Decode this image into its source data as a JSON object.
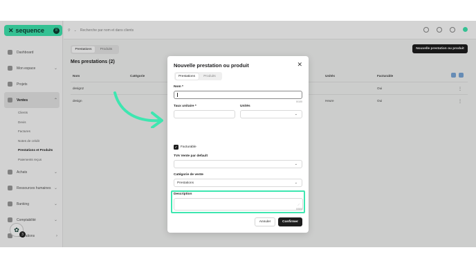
{
  "app": {
    "name": "sequence",
    "notif_count": "8"
  },
  "sidebar": {
    "items": [
      {
        "label": "Dashboard",
        "icon": "home-icon"
      },
      {
        "label": "Mon espace",
        "icon": "user-icon",
        "chevron": "⌄"
      },
      {
        "label": "Projets",
        "icon": "folder-icon"
      },
      {
        "label": "Ventes",
        "icon": "tag-icon",
        "chevron": "⌃",
        "active": true
      }
    ],
    "sub_items": [
      "Clients",
      "Devis",
      "Factures",
      "Notes de crédit",
      "Prestations et Produits",
      "Paiements reçus"
    ],
    "active_sub": "Prestations et Produits",
    "more_items": [
      {
        "label": "Achats",
        "chevron": "⌄"
      },
      {
        "label": "Ressources humaines",
        "chevron": "⌄"
      },
      {
        "label": "Banking",
        "chevron": "⌄"
      },
      {
        "label": "Comptabilité",
        "chevron": "⌄"
      },
      {
        "label": "Intégrations",
        "chevron": "›"
      }
    ],
    "chat_count": "3"
  },
  "topbar": {
    "search_placeholder": "Recherche par nom et dans clients"
  },
  "page": {
    "tabs": [
      "Prestations",
      "Produits"
    ],
    "new_button": "Nouvelle prestation ou produit",
    "title": "Mes prestations (2)",
    "columns": [
      "Nom",
      "Catégorie",
      "Unités",
      "Facturable"
    ],
    "rows": [
      {
        "nom": "design2",
        "unite": "",
        "facturable": "Oui"
      },
      {
        "nom": "design",
        "unite": "Heure",
        "facturable": "Oui"
      }
    ]
  },
  "modal": {
    "title": "Nouvelle prestation ou produit",
    "tabs": [
      "Prestations",
      "Produits"
    ],
    "nom_label": "Nom *",
    "nom_counter": "0/100",
    "taux_label": "Taux unitaire *",
    "unites_label": "Unités",
    "facturable_label": "Facturable",
    "tva_label": "TVA Vente par default",
    "categorie_label": "Catégorie de vente",
    "categorie_value": "Prestations",
    "description_label": "Description",
    "description_counter": "0/500",
    "cancel": "Annuler",
    "confirm": "Confirmer"
  },
  "colors": {
    "accent": "#3ee6b0",
    "dark": "#1d1d1d"
  }
}
